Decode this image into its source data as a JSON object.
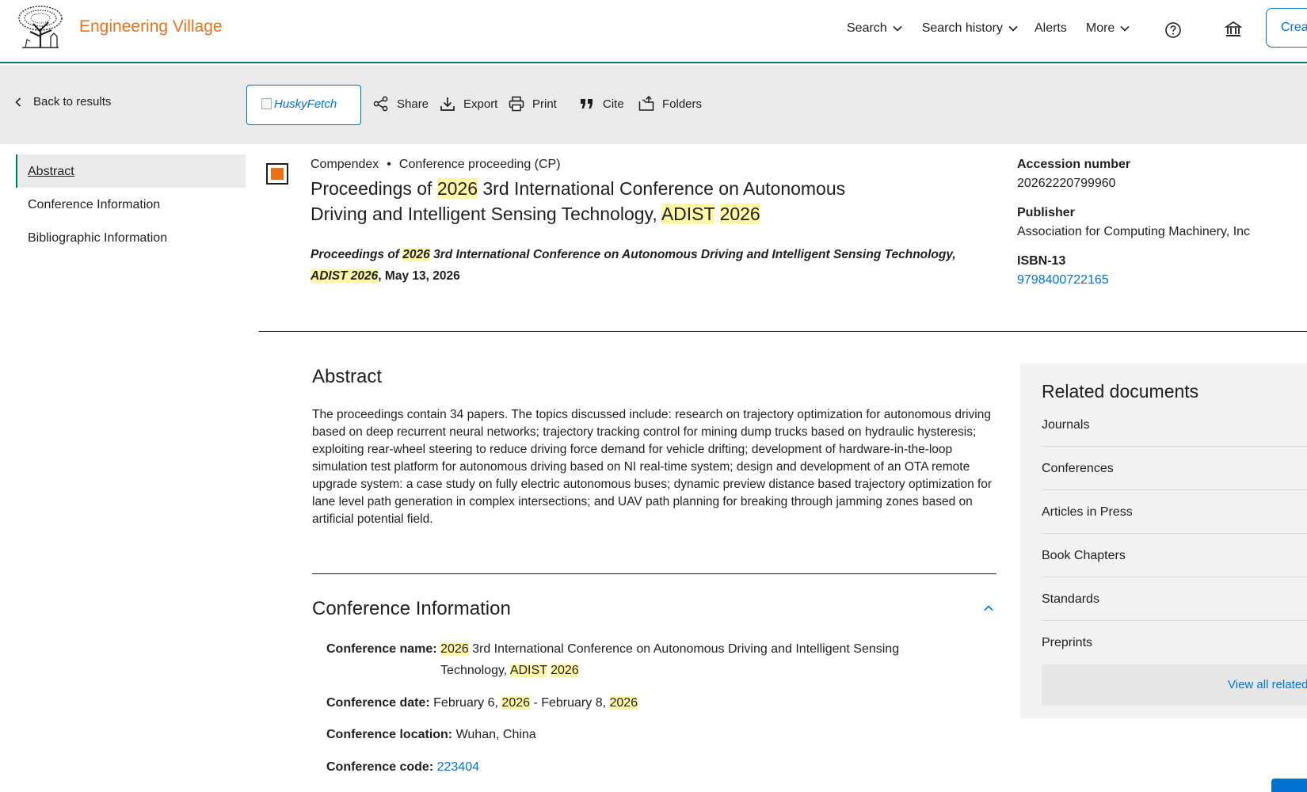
{
  "header": {
    "brand": "Engineering Village",
    "nav": [
      {
        "label": "Search",
        "has_dropdown": true
      },
      {
        "label": "Search history",
        "has_dropdown": true
      },
      {
        "label": "Alerts",
        "has_dropdown": false
      },
      {
        "label": "More",
        "has_dropdown": true
      }
    ],
    "create_label": "Crea"
  },
  "toolbar": {
    "back_label": "Back to results",
    "husky_label": "HuskyFetch",
    "share_label": "Share",
    "export_label": "Export",
    "print_label": "Print",
    "cite_label": "Cite",
    "folders_label": "Folders"
  },
  "side_nav": {
    "items": [
      "Abstract",
      "Conference Information",
      "Bibliographic Information"
    ]
  },
  "document": {
    "database": "Compendex",
    "doc_type": "Conference proceeding (CP)",
    "title_1": "Proceedings of ",
    "title_hl_1": "2026",
    "title_2": " 3rd International Conference on Autonomous Driving and Intelligent Sensing Technology, ",
    "title_hl_2": "ADIST",
    "title_3": " ",
    "title_hl_3": "2026",
    "source_1": "Proceedings of ",
    "source_hl_1": "2026",
    "source_2": " 3rd International Conference on Autonomous Driving and Intelligent Sensing Technology, ",
    "source_hl_2": "ADIST 2026",
    "source_date": ", May 13, 2026"
  },
  "meta": {
    "accession_label": "Accession number",
    "accession_value": "20262220799960",
    "publisher_label": "Publisher",
    "publisher_value": "Association for Computing Machinery, Inc",
    "isbn_label": "ISBN-13",
    "isbn_value": "9798400722165"
  },
  "abstract": {
    "title": "Abstract",
    "text": "The proceedings contain 34 papers. The topics discussed include: research on trajectory optimization for autonomous driving based on deep recurrent neural networks; trajectory tracking control for mining dump trucks based on hydraulic hysteresis; exploiting rear-wheel steering to reduce driving force demand for vehicle drifting; development of hardware-in-the-loop simulation test platform for autonomous driving based on NI real-time system; design and development of an OTA remote upgrade system: a case study on fully electric autonomous buses; dynamic preview distance based trajectory optimization for lane level path generation in complex intersections; and UAV path planning for breaking through jamming zones based on artificial potential field."
  },
  "conference": {
    "title": "Conference Information",
    "name_label": "Conference name:",
    "name_hl_1": "2026",
    "name_1": " 3rd International Conference on Autonomous Driving and Intelligent Sensing",
    "name_2": "Technology, ",
    "name_hl_2": "ADIST",
    "name_hl_3": "2026",
    "date_label": "Conference date:",
    "date_1": "February 6, ",
    "date_hl_1": "2026",
    "date_2": " - February 8, ",
    "date_hl_2": "2026",
    "location_label": "Conference location:",
    "location_value": "Wuhan, China",
    "code_label": "Conference code:",
    "code_value": "223404"
  },
  "related": {
    "title": "Related documents",
    "items": [
      "Journals",
      "Conferences",
      "Articles in Press",
      "Book Chapters",
      "Standards",
      "Preprints"
    ],
    "view_all": "View all related"
  },
  "colors": {
    "brand_orange": "#e9711c",
    "link_blue": "#0072ce",
    "header_rule": "#007a6c",
    "highlight": "#fff7a8",
    "toolbar_bg": "#eaeaea"
  }
}
